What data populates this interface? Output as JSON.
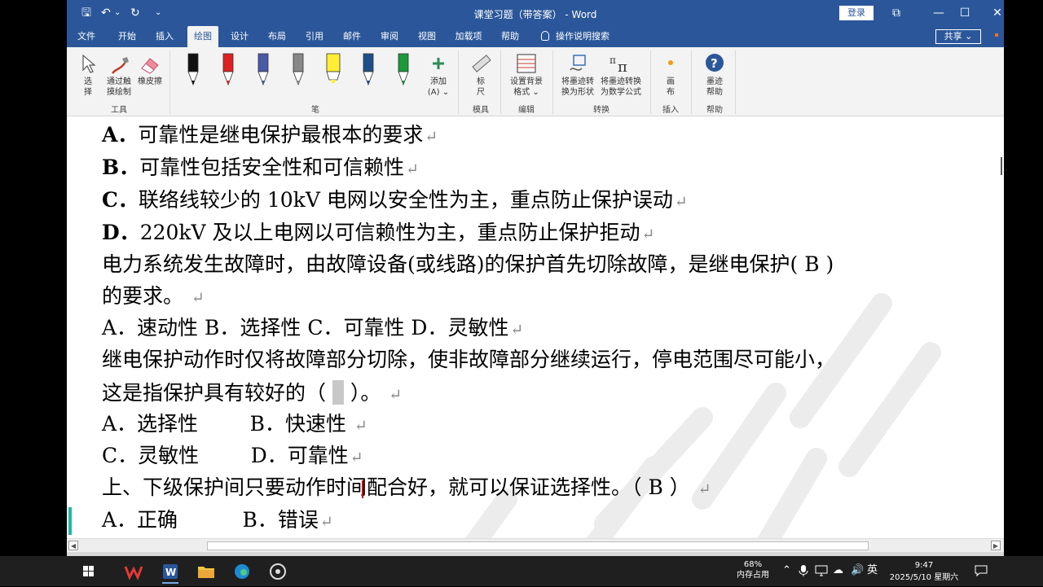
{
  "window": {
    "title": "课堂习题（带答案） - Word",
    "login_label": "登录",
    "minimize": "—",
    "maximize": "☐",
    "close": "✕",
    "restore": "⧉"
  },
  "quick_access": {
    "save": "🖫",
    "undo": "↶",
    "redo": "↻",
    "customize": "⌄"
  },
  "tabs": [
    "文件",
    "开始",
    "插入",
    "绘图",
    "设计",
    "布局",
    "引用",
    "邮件",
    "审阅",
    "视图",
    "加载项",
    "帮助"
  ],
  "tell_me": "操作说明搜索",
  "share": "共享",
  "ribbon": {
    "tools": {
      "select": "选\n择",
      "touch_draw": "通过触\n摸绘制",
      "eraser": "橡皮擦",
      "group": "工具"
    },
    "pens_group": "笔",
    "add": "添加\n(A) ⌄",
    "ruler": "标\n尺",
    "ruler_group": "模具",
    "background": "设置背景\n格式 ⌄",
    "edit_group": "编辑",
    "ink_to_shape": "将墨迹转\n换为形状",
    "ink_to_math": "将墨迹转换\n为数学公式",
    "convert_group": "转换",
    "canvas": "画\n布",
    "insert_group": "插入",
    "ink_help": "墨迹\n帮助",
    "help_group": "帮助",
    "pen_colors": [
      "#111111",
      "#e02020",
      "#4a5aa8",
      "#888888",
      "#ffee33",
      "#1e4f8a",
      "#1a9a3a"
    ]
  },
  "document": {
    "lines": [
      {
        "label": "A．",
        "text": "可靠性是继电保护最根本的要求"
      },
      {
        "label": "B．",
        "text": "可靠性包括安全性和可信赖性"
      },
      {
        "label": "C．",
        "text": "联络线较少的 10kV 电网以安全性为主，重点防止保护误动"
      },
      {
        "label": "D．",
        "text": "220kV 及以上电网以可信赖性为主，重点防止保护拒动"
      },
      {
        "text": "电力系统发生故障时，由故障设备(或线路)的保护首先切除故障，是继电保护(  B  )"
      },
      {
        "text": "的要求。"
      },
      {
        "text": "A．速动性  B．选择性  C．可靠性  D．灵敏性"
      },
      {
        "text": "继电保护动作时仅将故障部分切除，使非故障部分继续运行，停电范围尽可能小，"
      },
      {
        "text_before": "这是指保护具有较好的（",
        "text_after": "）。"
      },
      {
        "text": "A．选择性        B．快速性"
      },
      {
        "text": "C．灵敏性        D．可靠性"
      },
      {
        "text": "上、下级保护间只要动作时间配合好，就可以保证选择性。（  B  ）"
      },
      {
        "text": "A．正确          B．错误"
      }
    ],
    "para_mark": "↵"
  },
  "taskbar": {
    "memory_pct": "68%",
    "memory_label": "内存占用",
    "ime": "英",
    "time": "9:47",
    "date": "2025/5/10 星期六"
  }
}
